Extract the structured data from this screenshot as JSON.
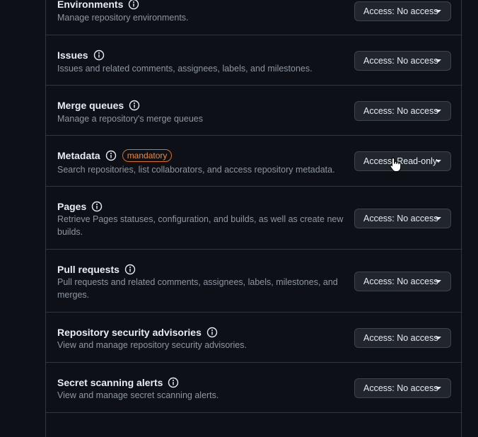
{
  "permissions": [
    {
      "name": "Environments",
      "description": "Manage repository environments.",
      "access_label": "Access: No access"
    },
    {
      "name": "Issues",
      "description": "Issues and related comments, assignees, labels, and milestones.",
      "access_label": "Access: No access"
    },
    {
      "name": "Merge queues",
      "description": "Manage a repository's merge queues",
      "access_label": "Access: No access"
    },
    {
      "name": "Metadata",
      "badge": "mandatory",
      "description": "Search repositories, list collaborators, and access repository metadata.",
      "access_label": "Access: Read-only"
    },
    {
      "name": "Pages",
      "description": "Retrieve Pages statuses, configuration, and builds, as well as create new builds.",
      "access_label": "Access: No access"
    },
    {
      "name": "Pull requests",
      "description": "Pull requests and related comments, assignees, labels, milestones, and merges.",
      "access_label": "Access: No access"
    },
    {
      "name": "Repository security advisories",
      "description": "View and manage repository security advisories.",
      "access_label": "Access: No access"
    },
    {
      "name": "Secret scanning alerts",
      "description": "View and manage secret scanning alerts.",
      "access_label": "Access: No access"
    }
  ],
  "colors": {
    "background": "#0d1117",
    "border": "#30363d",
    "text": "#e6edf3",
    "muted": "#8d96a0",
    "badge": "#db6d28"
  }
}
